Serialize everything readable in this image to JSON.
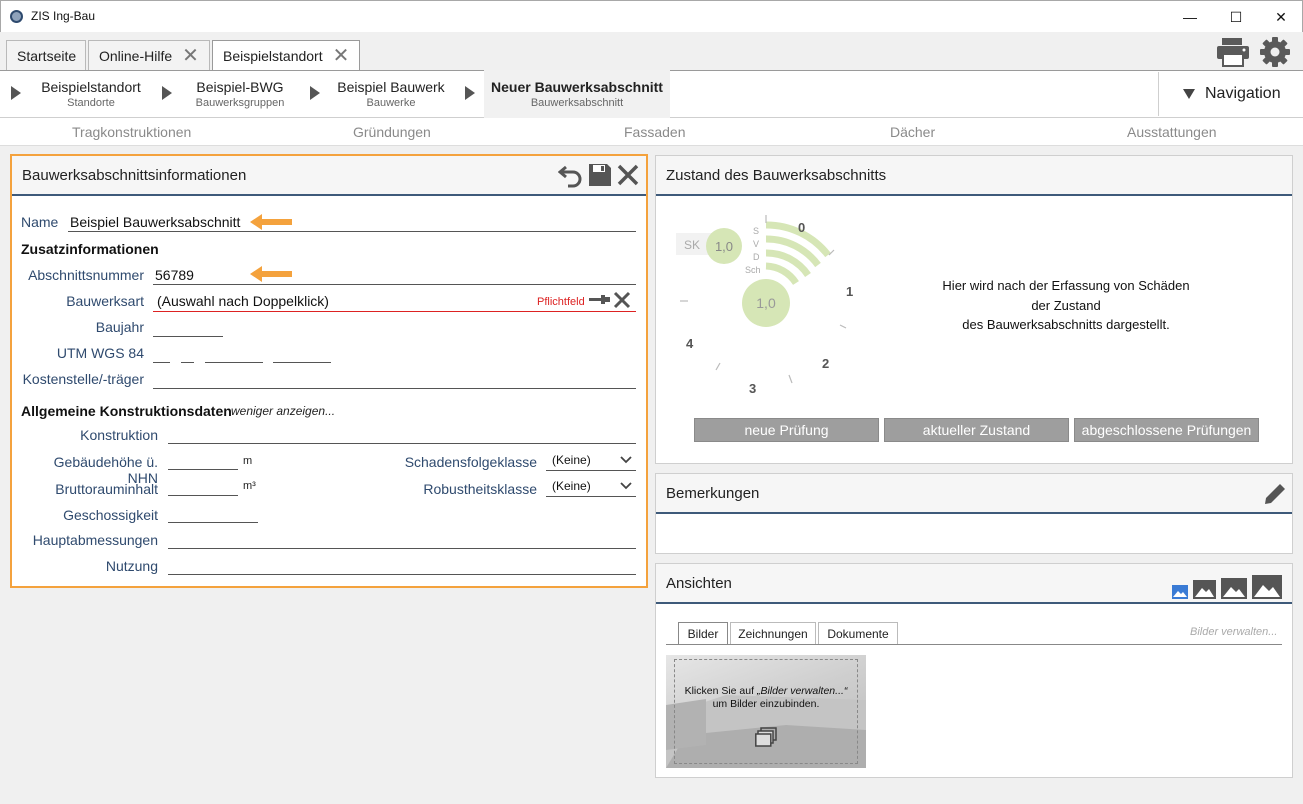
{
  "window": {
    "title": "ZIS Ing-Bau",
    "minimize": "—",
    "maximize": "☐",
    "close": "✕"
  },
  "tabs": [
    {
      "label": "Startseite"
    },
    {
      "label": "Online-Hilfe"
    },
    {
      "label": "Beispielstandort"
    }
  ],
  "breadcrumb": [
    {
      "title": "Beispielstandort",
      "sub": "Standorte"
    },
    {
      "title": "Beispiel-BWG",
      "sub": "Bauwerksgruppen"
    },
    {
      "title": "Beispiel Bauwerk",
      "sub": "Bauwerke"
    },
    {
      "title": "Neuer Bauwerksabschnitt",
      "sub": "Bauwerksabschnitt"
    }
  ],
  "navigation_label": "Navigation",
  "sections": [
    "Tragkonstruktionen",
    "Gründungen",
    "Fassaden",
    "Dächer",
    "Ausstattungen"
  ],
  "info_panel": {
    "title": "Bauwerksabschnittsinformationen",
    "name_label": "Name",
    "name_value": "Beispiel Bauwerksabschnitt",
    "zusatz_header": "Zusatzinformationen",
    "abschnitt_label": "Abschnittsnummer",
    "abschnitt_value": "56789",
    "bauwerksart_label": "Bauwerksart",
    "bauwerksart_value": "(Auswahl nach Doppelklick)",
    "pflichtfeld": "Pflichtfeld",
    "baujahr_label": "Baujahr",
    "utm_label": "UTM WGS 84",
    "kosten_label": "Kostenstelle/-träger",
    "allgemein_header": "Allgemeine Konstruktionsdaten",
    "weniger": "weniger anzeigen...",
    "konstruktion_label": "Konstruktion",
    "hoehe_label": "Gebäudehöhe ü. NHN",
    "hoehe_unit": "m",
    "brutto_label": "Bruttorauminhalt",
    "brutto_unit": "m³",
    "geschoss_label": "Geschossigkeit",
    "haupt_label": "Hauptabmessungen",
    "nutzung_label": "Nutzung",
    "schaden_label": "Schadensfolgeklasse",
    "schaden_value": "(Keine)",
    "robust_label": "Robustheitsklasse",
    "robust_value": "(Keine)"
  },
  "zustand_panel": {
    "title": "Zustand des Bauwerksabschnitts",
    "sk_label": "SK",
    "sk_value": "1,0",
    "main_value": "1,0",
    "svd": [
      "S",
      "V",
      "D",
      "Sch"
    ],
    "gauge_numbers": [
      "0",
      "1",
      "2",
      "3",
      "4"
    ],
    "message_line1": "Hier wird nach der Erfassung von Schäden",
    "message_line2": "der Zustand",
    "message_line3": "des Bauwerksabschnitts dargestellt.",
    "btn_neue": "neue Prüfung",
    "btn_aktuell": "aktueller Zustand",
    "btn_abgeschlossen": "abgeschlossene Prüfungen"
  },
  "bemerkungen_panel": {
    "title": "Bemerkungen"
  },
  "ansichten_panel": {
    "title": "Ansichten",
    "tabs": [
      "Bilder",
      "Zeichnungen",
      "Dokumente"
    ],
    "manage": "Bilder verwalten...",
    "hint_prefix": "Klicken Sie auf ",
    "hint_em": "„Bilder verwalten...“",
    "hint_line2": "um Bilder einzubinden."
  },
  "colors": {
    "accent_orange": "#f4a23d",
    "header_line": "#3e5a7a",
    "label_blue": "#2f4a6e",
    "gauge_green": "#d6e6b6",
    "required_red": "#d22"
  }
}
